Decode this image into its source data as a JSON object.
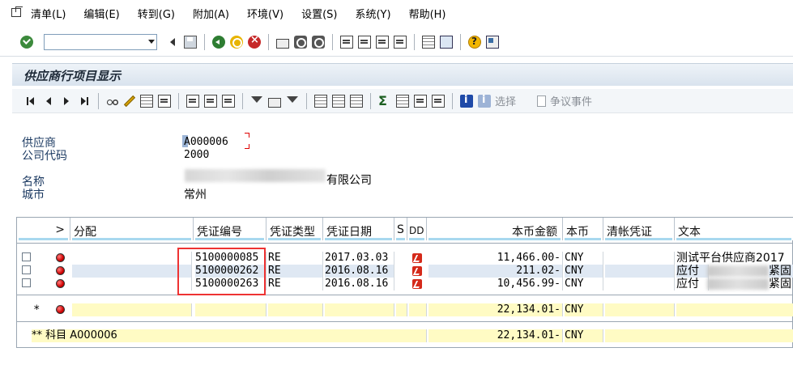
{
  "menu": {
    "items": [
      "清单(L)",
      "编辑(E)",
      "转到(G)",
      "附加(A)",
      "环境(V)",
      "设置(S)",
      "系统(Y)",
      "帮助(H)"
    ]
  },
  "std_toolbar": {
    "command_field_value": "",
    "icons": [
      "enter-icon",
      "back-arrow-icon",
      "save-icon",
      "back-icon",
      "exit-icon",
      "cancel-icon",
      "print-icon",
      "find-icon",
      "find-next-icon",
      "first-page-icon",
      "prev-page-icon",
      "next-page-icon",
      "last-page-icon",
      "create-session-icon",
      "shortcut-icon",
      "help-icon",
      "layout-icon"
    ]
  },
  "title": "供应商行项目显示",
  "app_toolbar": {
    "select_label": "选择",
    "dispute_label": "争议事件"
  },
  "header": {
    "vendor_label": "供应商",
    "vendor_value": "A000006",
    "company_code_label": "公司代码",
    "company_code_value": "2000",
    "name_label": "名称",
    "name_value_suffix": "有限公司",
    "city_label": "城市",
    "city_value": "常州"
  },
  "table": {
    "columns": {
      "sel": ">",
      "assignment": "分配",
      "doc_no": "凭证编号",
      "doc_type": "凭证类型",
      "doc_date": "凭证日期",
      "s": "S",
      "dd": "DD",
      "amount": "本币金额",
      "currency": "本币",
      "clearing": "清帐凭证",
      "text": "文本"
    },
    "rows": [
      {
        "doc_no": "5100000085",
        "doc_type": "RE",
        "doc_date": "2017.03.03",
        "amount": "11,466.00-",
        "currency": "CNY",
        "text": "测试平台供应商2017"
      },
      {
        "doc_no": "5100000262",
        "doc_type": "RE",
        "doc_date": "2016.08.16",
        "amount": "211.02-",
        "currency": "CNY",
        "text": "应付",
        "text_tail": "紧固"
      },
      {
        "doc_no": "5100000263",
        "doc_type": "RE",
        "doc_date": "2016.08.16",
        "amount": "10,456.99-",
        "currency": "CNY",
        "text": "应付",
        "text_tail": "紧固"
      }
    ],
    "subtotal": {
      "marker": "*",
      "amount": "22,134.01-",
      "currency": "CNY"
    },
    "total": {
      "label": "** 科目 A000006",
      "amount": "22,134.01-",
      "currency": "CNY"
    }
  },
  "colors": {
    "header_bar": "#a8d8ef",
    "row_highlight": "#dfe8f3",
    "subtotal_bg": "#fffbc4",
    "annotation_red": "#e33333"
  }
}
